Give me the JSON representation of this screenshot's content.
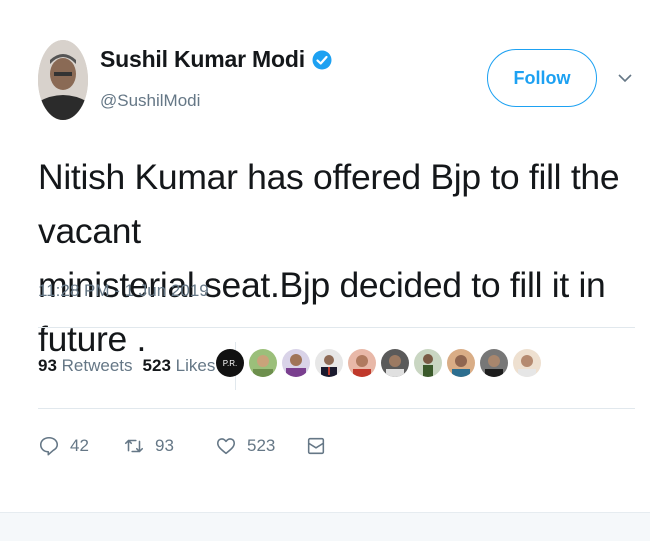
{
  "author": {
    "name": "Sushil Kumar Modi",
    "handle": "@SushilModi",
    "verified": true
  },
  "follow_label": "Follow",
  "tweet": {
    "text_line1": "Nitish Kumar has offered Bjp to fill the vacant",
    "text_line2": "ministerial seat.Bjp decided to fill it in future .",
    "timestamp": "11:28 PM - 1 Jun 2019"
  },
  "stats": {
    "retweets_count": "93",
    "retweets_label": "Retweets",
    "likes_count": "523",
    "likes_label": "Likes"
  },
  "likers": [
    {
      "label": "P.R."
    },
    {
      "label": ""
    },
    {
      "label": ""
    },
    {
      "label": ""
    },
    {
      "label": ""
    },
    {
      "label": ""
    },
    {
      "label": ""
    },
    {
      "label": ""
    },
    {
      "label": ""
    },
    {
      "label": ""
    }
  ],
  "actions": {
    "reply_count": "42",
    "retweet_count": "93",
    "like_count": "523"
  },
  "colors": {
    "accent": "#1da1f2",
    "muted": "#657786",
    "text": "#14171a",
    "divider": "#e1e8ed"
  }
}
